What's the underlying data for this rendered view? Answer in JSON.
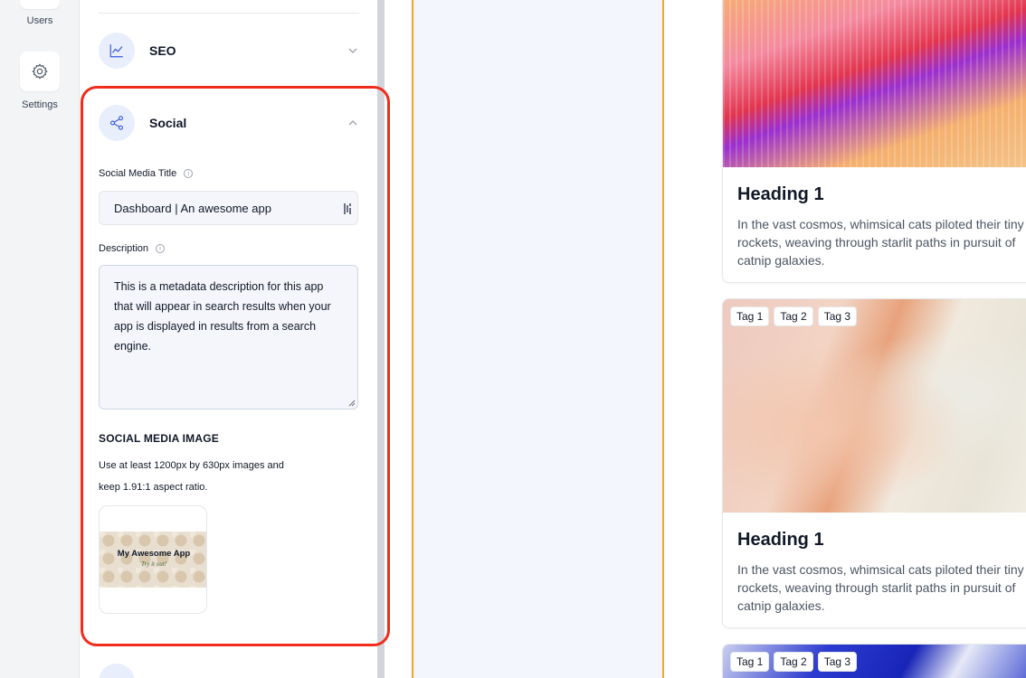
{
  "rail": {
    "items": [
      {
        "label": "Users",
        "icon": "users-icon"
      },
      {
        "label": "Settings",
        "icon": "gear-icon"
      }
    ]
  },
  "panel": {
    "seo": {
      "title": "SEO",
      "icon": "chart-line-icon",
      "state": "collapsed"
    },
    "social": {
      "title": "Social",
      "icon": "share-icon",
      "state": "expanded",
      "title_label": "Social Media Title",
      "title_value": "Dashboard |  An awesome app",
      "description_label": "Description",
      "description_value": "This is a metadata description for this app that will appear in search results when your app is displayed in results from a search engine.",
      "image_heading": "SOCIAL MEDIA IMAGE",
      "image_help_line1": "Use at least 1200px by 630px images and",
      "image_help_line2": "keep 1.91:1 aspect ratio.",
      "thumb_title": "My Awesome App",
      "thumb_subtitle": "Try it out!"
    }
  },
  "cards": [
    {
      "heading": "Heading 1",
      "body": "In the vast cosmos, whimsical cats piloted their tiny rockets, weaving through starlit paths in pursuit of catnip galaxies.",
      "tags": []
    },
    {
      "heading": "Heading 1",
      "body": "In the vast cosmos, whimsical cats piloted their tiny rockets, weaving through starlit paths in pursuit of catnip galaxies.",
      "tags": [
        "Tag 1",
        "Tag 2",
        "Tag 3"
      ]
    },
    {
      "heading": "",
      "body": "",
      "tags": [
        "Tag 1",
        "Tag 2",
        "Tag 3"
      ]
    }
  ],
  "colors": {
    "accent_highlight": "#f12c1c",
    "column_border": "#f5a524",
    "icon_bg": "#e8eefb"
  }
}
